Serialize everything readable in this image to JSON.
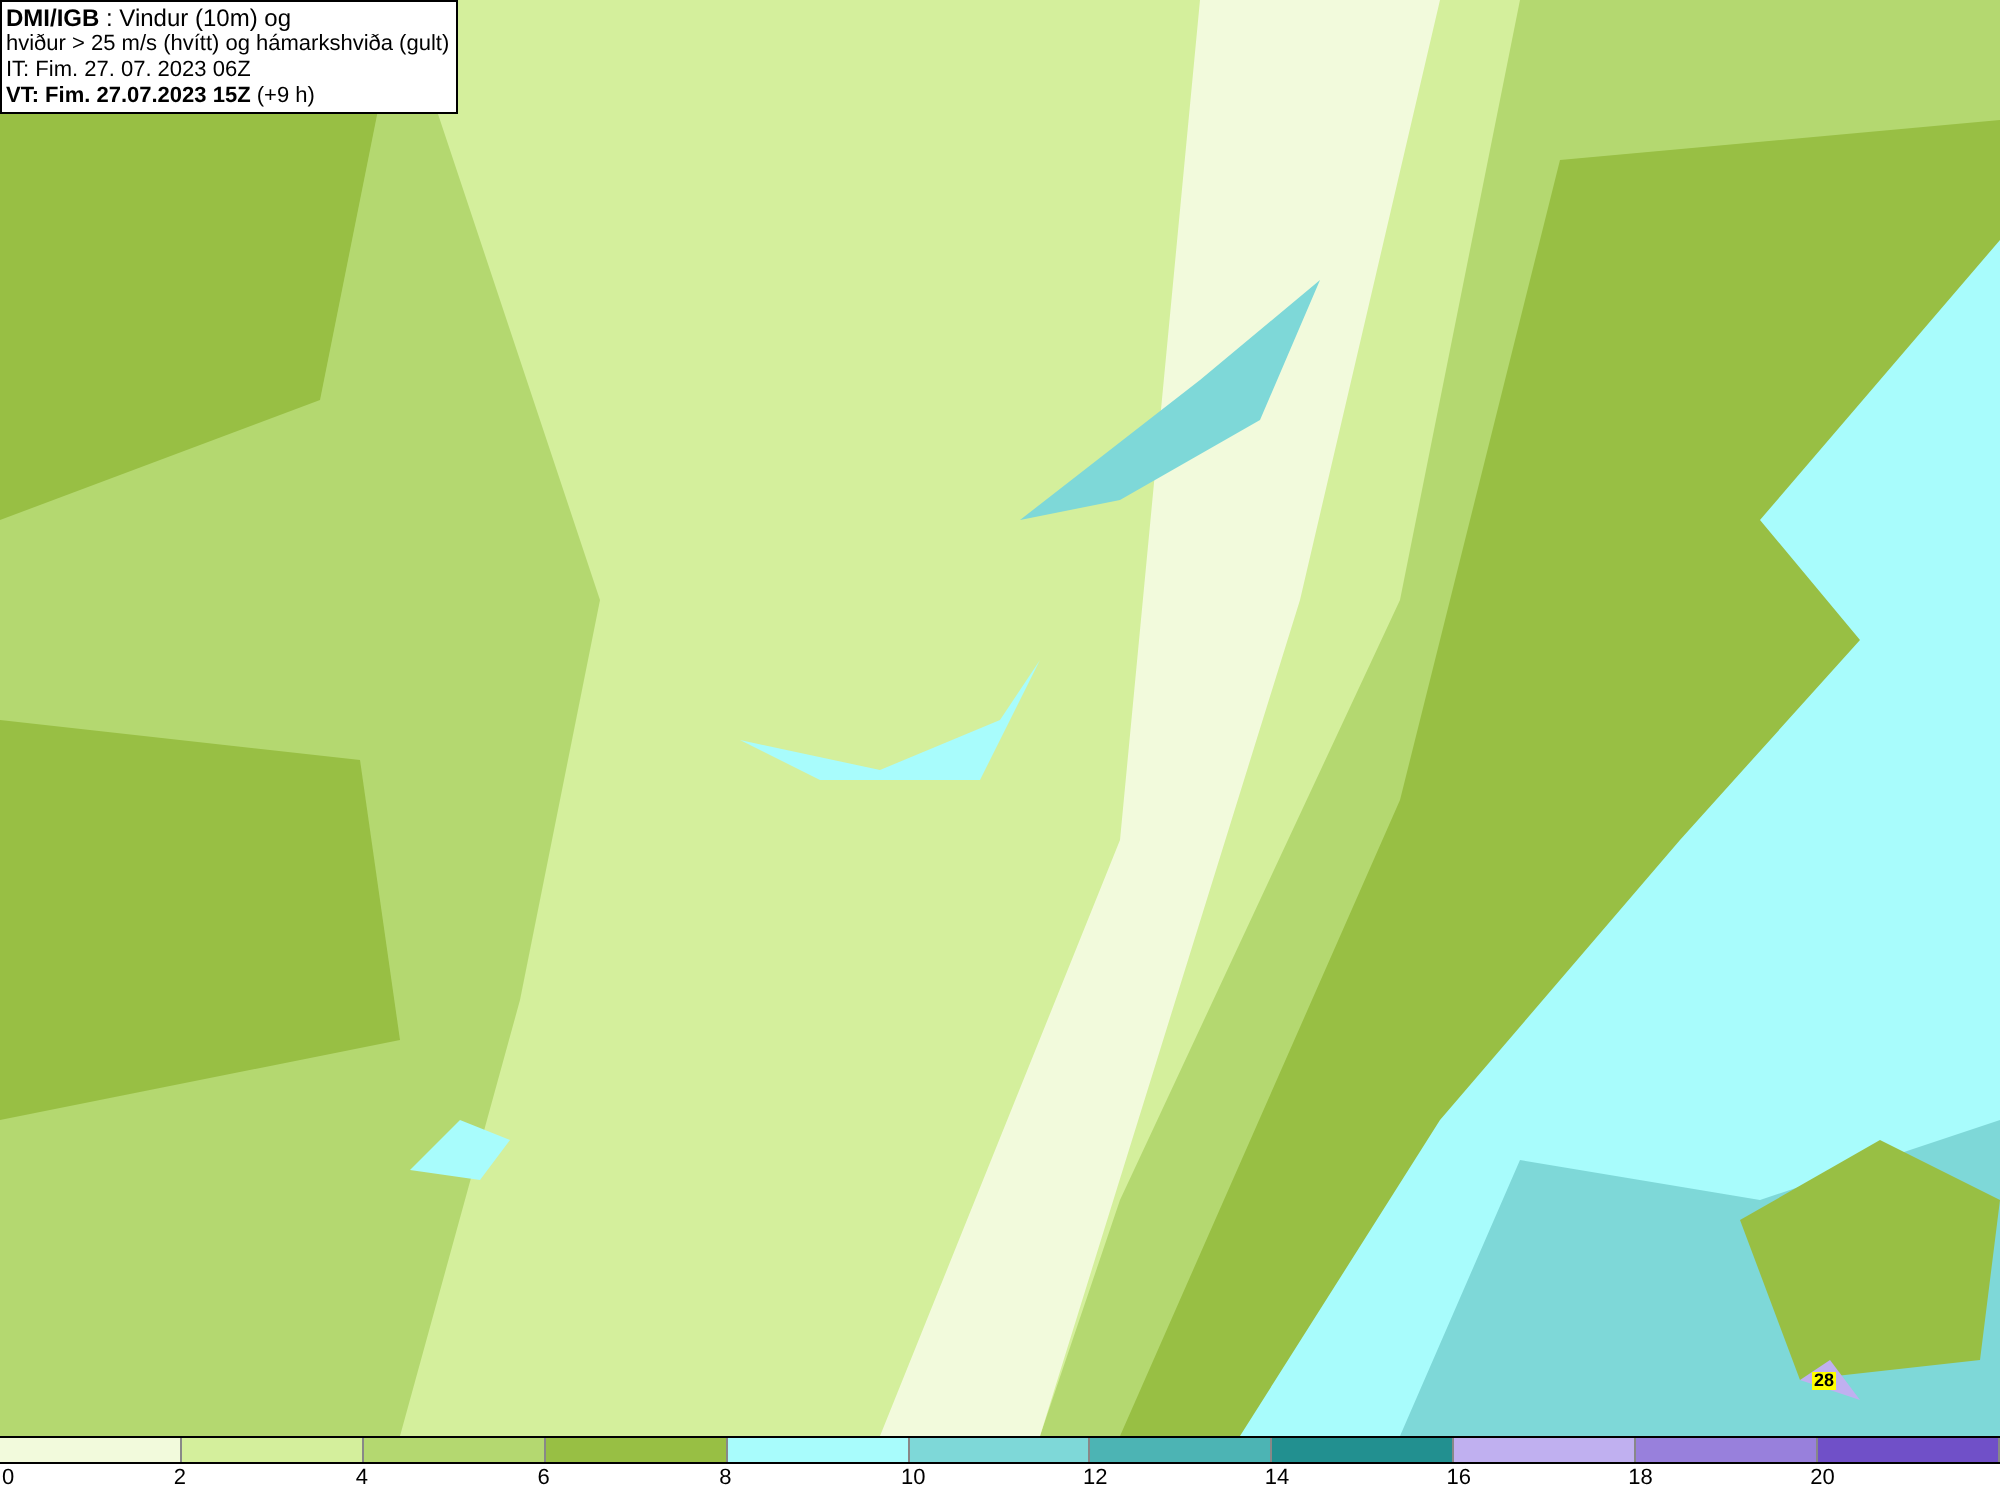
{
  "title_box": {
    "lines": [
      "**DMI/IGB** : Vindur (10m) og",
      "hviður > 25 m/s (hvítt) og hámarkshviða (gult)",
      "IT: Fim. 27. 07. 2023 06Z",
      "**VT: Fim. 27.07.2023 15Z** (+9 h)"
    ]
  },
  "map": {
    "gust_marker": "28"
  },
  "legend": {
    "bins": [
      {
        "color": "#f2fadc"
      },
      {
        "color": "#d4ef9c"
      },
      {
        "color": "#b4d870"
      },
      {
        "color": "#98bf44"
      },
      {
        "color": "#a8fcfc"
      },
      {
        "color": "#7ed8d8"
      },
      {
        "color": "#4cb4b4"
      },
      {
        "color": "#229090"
      },
      {
        "color": "#c0b0f0"
      },
      {
        "color": "#9880dc"
      },
      {
        "color": "#7050c8"
      }
    ],
    "labels": [
      "0",
      "2",
      "4",
      "6",
      "8",
      "10",
      "12",
      "14",
      "16",
      "18",
      "20"
    ]
  }
}
